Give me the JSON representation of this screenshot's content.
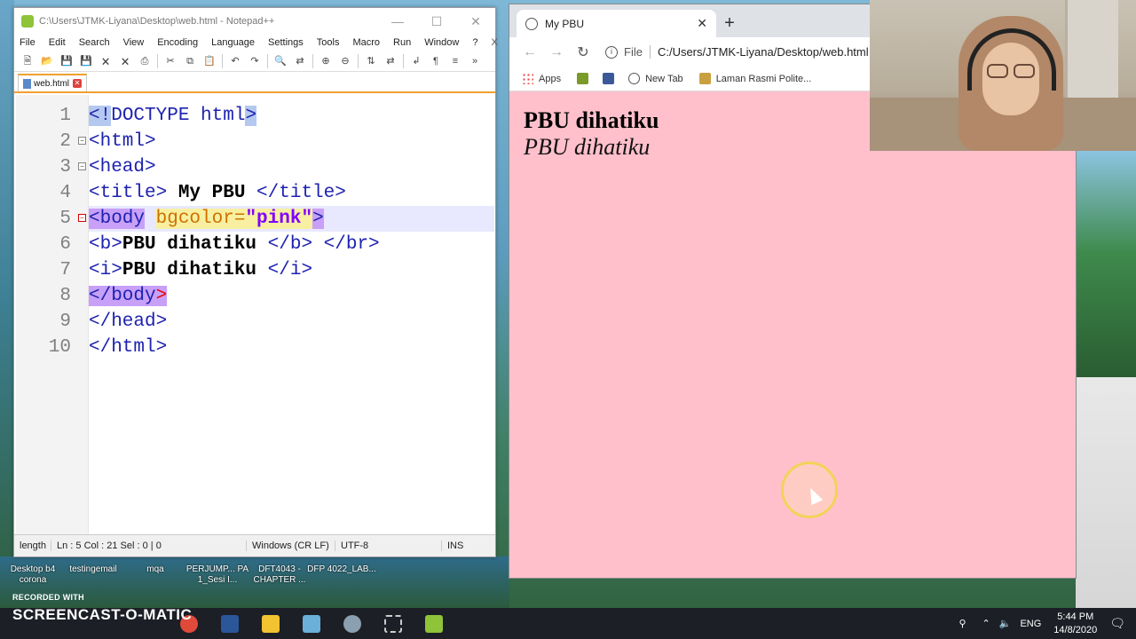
{
  "desktop": {
    "icons": [
      "Desktop b4 corona",
      "testingemail",
      "mqa",
      "PERJUMP... PA 1_Sesi I...",
      "DFT4043 - CHAPTER ...",
      "DFP 4022_LAB..."
    ]
  },
  "notepad": {
    "title": "C:\\Users\\JTMK-Liyana\\Desktop\\web.html - Notepad++",
    "menu": [
      "File",
      "Edit",
      "Search",
      "View",
      "Encoding",
      "Language",
      "Settings",
      "Tools",
      "Macro",
      "Run",
      "Window",
      "?"
    ],
    "menu_close": "X",
    "tab": "web.html",
    "line_numbers": [
      "1",
      "2",
      "3",
      "4",
      "5",
      "6",
      "7",
      "8",
      "9",
      "10"
    ],
    "code": {
      "l1_a": "<!",
      "l1_b": "DOCTYPE html",
      "l1_c": ">",
      "l2": "<html>",
      "l3": "<head>",
      "l4_a": "<title>",
      "l4_b": " My PBU ",
      "l4_c": "</title>",
      "l5_a": "<body",
      "l5_b": "bgcolor=",
      "l5_c": "\"pink\"",
      "l5_d": ">",
      "l6_a": "<b>",
      "l6_b": "PBU dihatiku ",
      "l6_c": "</b> </br>",
      "l7_a": "<i>",
      "l7_b": "PBU dihatiku ",
      "l7_c": "</i>",
      "l8_a": "</body",
      "l8_b": ">",
      "l9": "</head>",
      "l10": "</html>"
    },
    "status": {
      "type": "length",
      "position": "Ln : 5    Col : 21    Sel : 0 | 0",
      "eol": "Windows (CR LF)",
      "encoding": "UTF-8",
      "mode": "INS"
    }
  },
  "chrome": {
    "tab_title": "My PBU",
    "new_tab": "+",
    "url_label": "File",
    "url": "C:/Users/JTMK-Liyana/Desktop/web.html",
    "bookmarks": [
      "Apps",
      "New Tab",
      "Laman Rasmi Polite..."
    ],
    "page": {
      "bold_text": "PBU dihatiku",
      "italic_text": "PBU dihatiku",
      "bgcolor": "#ffc0cb"
    }
  },
  "recorder": {
    "recorded_with": "RECORDED WITH",
    "brand": "SCREENCAST-O-MATIC"
  },
  "taskbar": {
    "lang": "ENG",
    "time": "5:44 PM",
    "date": "14/8/2020"
  }
}
